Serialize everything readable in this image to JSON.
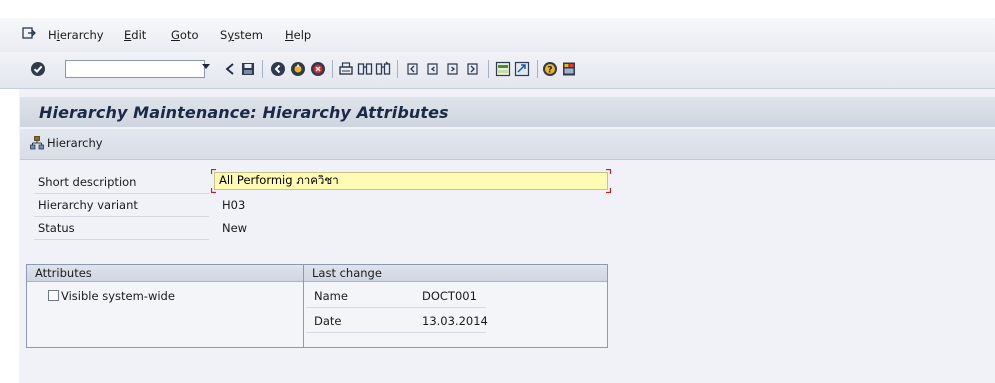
{
  "menu": {
    "items": [
      {
        "label": "Hierarchy",
        "access": "i"
      },
      {
        "label": "Edit",
        "access": "E"
      },
      {
        "label": "Goto",
        "access": "G"
      },
      {
        "label": "System",
        "access": "y"
      },
      {
        "label": "Help",
        "access": "H"
      }
    ]
  },
  "command_field": {
    "value": ""
  },
  "page": {
    "title": "Hierarchy Maintenance: Hierarchy Attributes"
  },
  "app_toolbar": {
    "hierarchy_button": "Hierarchy"
  },
  "form": {
    "short_description": {
      "label": "Short description",
      "value": "All Performig ภาควิชา"
    },
    "hierarchy_variant": {
      "label": "Hierarchy variant",
      "value": "H03"
    },
    "status": {
      "label": "Status",
      "value": "New"
    }
  },
  "attributes": {
    "title": "Attributes",
    "visible_system_wide": {
      "label": "Visible system-wide",
      "checked": false
    }
  },
  "last_change": {
    "title": "Last change",
    "name": {
      "label": "Name",
      "value": "DOCT001"
    },
    "date": {
      "label": "Date",
      "value": "13.03.2014"
    }
  },
  "colors": {
    "title_text": "#1a2a45",
    "input_required_bg": "#fffbb4",
    "corner_marker": "#d11a1a"
  }
}
